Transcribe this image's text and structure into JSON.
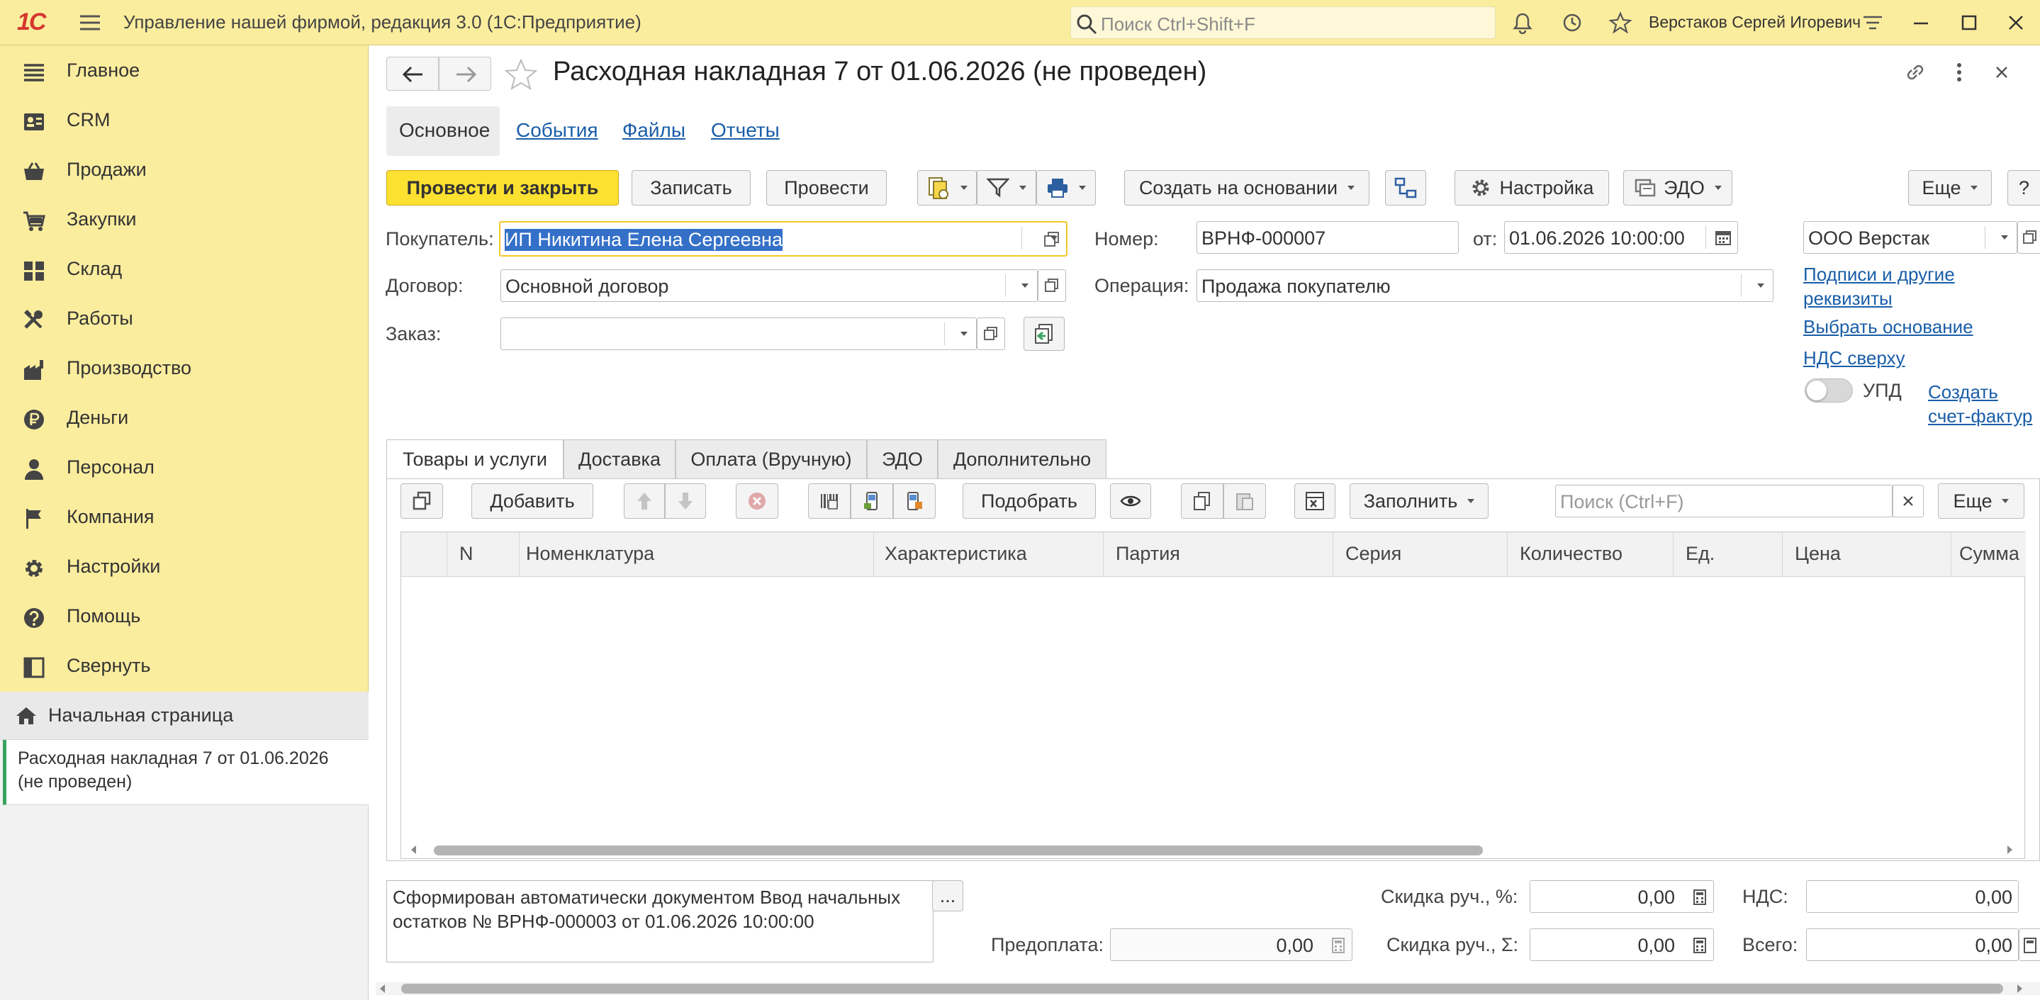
{
  "app": {
    "title": "Управление нашей фирмой, редакция 3.0  (1С:Предприятие)",
    "logo": "1С",
    "search_placeholder": "Поиск Ctrl+Shift+F",
    "user": "Верстаков Сергей Игоревич"
  },
  "sidebar": {
    "items": [
      {
        "label": "Главное",
        "icon": "menu-icon"
      },
      {
        "label": "CRM",
        "icon": "contacts-icon"
      },
      {
        "label": "Продажи",
        "icon": "basket-icon"
      },
      {
        "label": "Закупки",
        "icon": "cart-icon"
      },
      {
        "label": "Склад",
        "icon": "warehouse-icon"
      },
      {
        "label": "Работы",
        "icon": "tools-icon"
      },
      {
        "label": "Производство",
        "icon": "factory-icon"
      },
      {
        "label": "Деньги",
        "icon": "ruble-icon"
      },
      {
        "label": "Персонал",
        "icon": "person-icon"
      },
      {
        "label": "Компания",
        "icon": "flag-icon"
      },
      {
        "label": "Настройки",
        "icon": "gear-icon"
      },
      {
        "label": "Помощь",
        "icon": "help-icon"
      },
      {
        "label": "Свернуть",
        "icon": "collapse-icon"
      }
    ],
    "home": "Начальная страница",
    "open_document": "Расходная накладная 7 от 01.06.2026 (не проведен)"
  },
  "document": {
    "title": "Расходная накладная 7 от 01.06.2026 (не проведен)",
    "tabs": [
      "Основное",
      "События",
      "Файлы",
      "Отчеты"
    ],
    "toolbar": {
      "post_close": "Провести и закрыть",
      "save": "Записать",
      "post": "Провести",
      "create_based": "Создать на основании",
      "settings": "Настройка",
      "edo": "ЭДО",
      "more": "Еще",
      "help": "?"
    },
    "fields": {
      "buyer_label": "Покупатель:",
      "buyer_value": "ИП Никитина Елена Сергеевна",
      "contract_label": "Договор:",
      "contract_value": "Основной договор",
      "order_label": "Заказ:",
      "order_value": "",
      "number_label": "Номер:",
      "number_value": "ВРНФ-000007",
      "date_label": "от:",
      "date_value": "01.06.2026 10:00:00",
      "operation_label": "Операция:",
      "operation_value": "Продажа покупателю",
      "company_value": "ООО Верстак"
    },
    "links": {
      "signatures": "Подписи и другие реквизиты",
      "choose_base": "Выбрать основание",
      "vat_top": "НДС сверху",
      "upd_label": "УПД",
      "create_invoice": "Создать счет-фактур"
    },
    "page_tabs": [
      "Товары и услуги",
      "Доставка",
      "Оплата (Вручную)",
      "ЭДО",
      "Дополнительно"
    ],
    "table_toolbar": {
      "add": "Добавить",
      "pick": "Подобрать",
      "fill": "Заполнить",
      "search_placeholder": "Поиск (Ctrl+F)",
      "more": "Еще"
    },
    "columns": [
      "N",
      "Номенклатура",
      "Характеристика",
      "Партия",
      "Серия",
      "Количество",
      "Ед.",
      "Цена",
      "Сумма"
    ],
    "comment": "Сформирован автоматически документом Ввод начальных остатков № ВРНФ-000003 от 01.06.2026 10:00:00",
    "comment_btn": "...",
    "totals": {
      "prepay_label": "Предоплата:",
      "prepay_value": "0,00",
      "discount_pct_label": "Скидка руч., %:",
      "discount_pct_value": "0,00",
      "discount_sum_label": "Скидка руч., Σ:",
      "discount_sum_value": "0,00",
      "vat_label": "НДС:",
      "vat_value": "0,00",
      "total_label": "Всего:",
      "total_value": "0,00"
    }
  }
}
